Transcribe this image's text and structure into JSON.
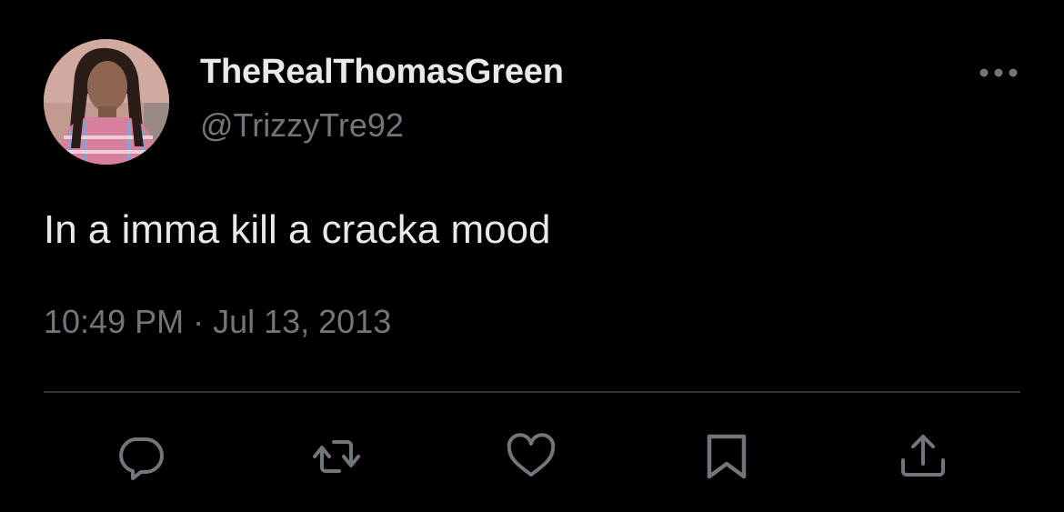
{
  "author": {
    "display_name": "TheRealThomasGreen",
    "handle": "@TrizzyTre92"
  },
  "tweet": {
    "text": "In a imma kill a cracka mood",
    "timestamp": "10:49 PM · Jul 13, 2013"
  },
  "icons": {
    "more": "more-horizontal-icon",
    "reply": "reply-icon",
    "retweet": "retweet-icon",
    "like": "heart-icon",
    "bookmark": "bookmark-icon",
    "share": "share-icon"
  },
  "colors": {
    "background": "#000000",
    "primary_text": "#e7e9ea",
    "secondary_text": "#71767b",
    "divider": "#2f3336"
  }
}
